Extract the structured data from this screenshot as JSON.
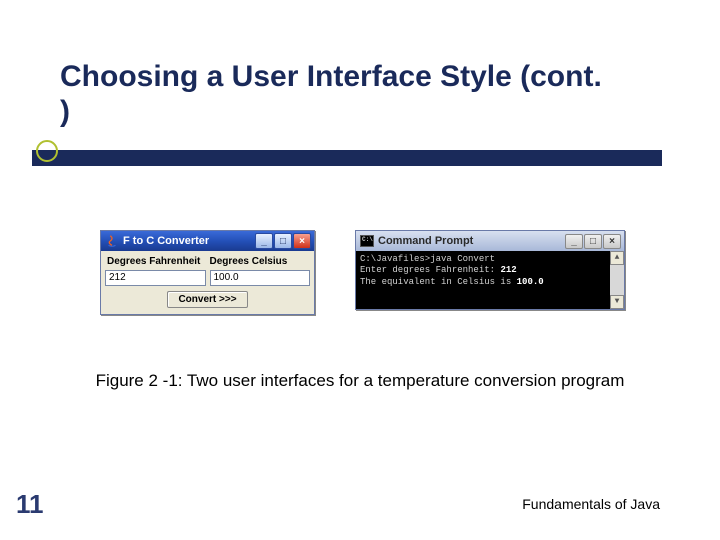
{
  "title": "Choosing a User Interface Style (cont. )",
  "gui": {
    "window_title": "F to C Converter",
    "label_f": "Degrees Fahrenheit",
    "label_c": "Degrees Celsius",
    "value_f": "212",
    "value_c": "100.0",
    "convert_label": "Convert >>>"
  },
  "console": {
    "window_title": "Command Prompt",
    "line1_prefix": "C:\\Javafiles>",
    "line1_cmd": "java Convert",
    "line2_prefix": "Enter degrees Fahrenheit: ",
    "line2_value": "212",
    "line3_prefix": "The equivalent in Celsius is ",
    "line3_value": "100.0"
  },
  "caption": "Figure 2 -1: Two user interfaces for a temperature conversion program",
  "page_number": "11",
  "footer": "Fundamentals of Java"
}
